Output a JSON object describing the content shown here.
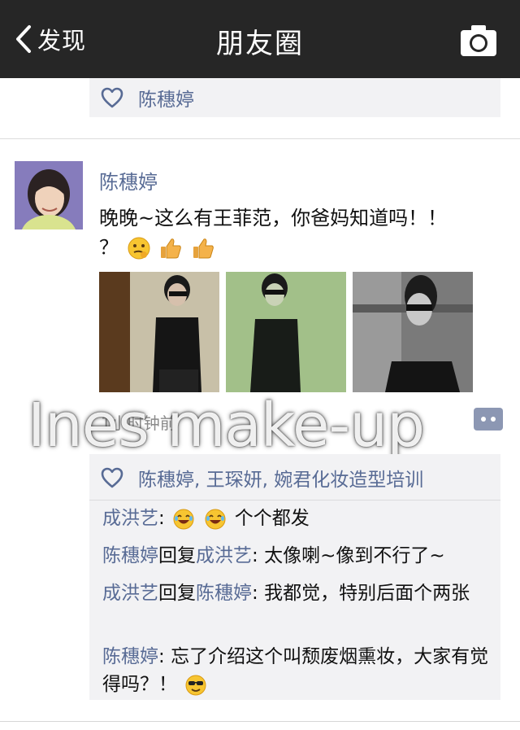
{
  "nav": {
    "back_label": "发现",
    "title": "朋友圈"
  },
  "prev_post": {
    "likes": "陈穗婷"
  },
  "post": {
    "author": "陈穗婷",
    "text_line1": "晚晚~这么有王菲范，你爸妈知道吗！！",
    "text_line2": "？",
    "time": "1小时钟前",
    "watermark": "Ines make-up",
    "likes": "陈穗婷, 王琛妍, 婉君化妆造型培训",
    "comments": [
      {
        "author": "成洪艺",
        "sep": ": ",
        "text": "个个都发"
      },
      {
        "author": "陈穗婷",
        "reply_word": "回复",
        "reply_to": "成洪艺",
        "sep": ": ",
        "text": "太像喇~像到不行了~"
      },
      {
        "author": "成洪艺",
        "reply_word": "回复",
        "reply_to": "陈穗婷",
        "sep": ": ",
        "text": "我都觉，特别后面个两张"
      },
      {
        "author": "陈穗婷",
        "sep": ": ",
        "text": "忘了介绍这个叫颓废烟熏妆，大家有觉得吗？！"
      }
    ]
  },
  "colors": {
    "navbar": "#262626",
    "name_link": "#586b95",
    "panel": "#f2f2f4"
  },
  "icons": [
    "chevron-left-icon",
    "camera-icon",
    "heart-icon",
    "comment-icon",
    "thinking-emoji-icon",
    "thumbs-up-emoji-icon",
    "laughing-emoji-icon",
    "cool-emoji-icon"
  ]
}
